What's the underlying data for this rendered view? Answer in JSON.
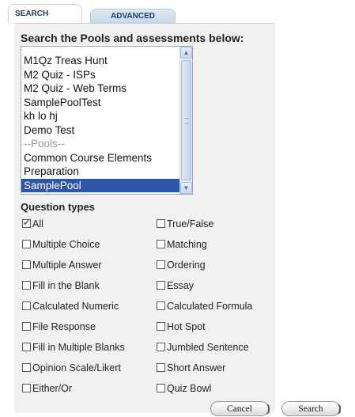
{
  "tabs": [
    {
      "label": "SEARCH",
      "active": true
    },
    {
      "label": "ADVANCED",
      "active": false
    }
  ],
  "heading": "Search the Pools and assessments below:",
  "listbox": {
    "items": [
      {
        "label": "M1Qz Treas Hunt",
        "type": "item"
      },
      {
        "label": "M2 Quiz - ISPs",
        "type": "item"
      },
      {
        "label": "M2 Quiz - Web Terms",
        "type": "item"
      },
      {
        "label": "SamplePoolTest",
        "type": "item"
      },
      {
        "label": "kh lo hj",
        "type": "item"
      },
      {
        "label": "Demo Test",
        "type": "item"
      },
      {
        "label": "--Pools--",
        "type": "group"
      },
      {
        "label": "Common Course Elements",
        "type": "item"
      },
      {
        "label": "Preparation",
        "type": "item"
      },
      {
        "label": "SamplePool",
        "type": "item",
        "selected": true
      }
    ]
  },
  "question_types_label": "Question types",
  "question_types": [
    {
      "label": "All",
      "checked": true
    },
    {
      "label": "True/False",
      "checked": false
    },
    {
      "label": "Multiple Choice",
      "checked": false
    },
    {
      "label": "Matching",
      "checked": false
    },
    {
      "label": "Multiple Answer",
      "checked": false
    },
    {
      "label": "Ordering",
      "checked": false
    },
    {
      "label": "Fill in the Blank",
      "checked": false
    },
    {
      "label": "Essay",
      "checked": false
    },
    {
      "label": "Calculated Numeric",
      "checked": false
    },
    {
      "label": "Calculated Formula",
      "checked": false
    },
    {
      "label": "File Response",
      "checked": false
    },
    {
      "label": "Hot Spot",
      "checked": false
    },
    {
      "label": "Fill in Multiple Blanks",
      "checked": false
    },
    {
      "label": "Jumbled Sentence",
      "checked": false
    },
    {
      "label": "Opinion Scale/Likert",
      "checked": false
    },
    {
      "label": "Short Answer",
      "checked": false
    },
    {
      "label": "Either/Or",
      "checked": false
    },
    {
      "label": "Quiz Bowl",
      "checked": false
    }
  ],
  "buttons": {
    "cancel": "Cancel",
    "search": "Search"
  },
  "colors": {
    "selected_bg": "#2d55a8",
    "tab_text": "#1a3a6a",
    "check": "#2a8a2a"
  }
}
